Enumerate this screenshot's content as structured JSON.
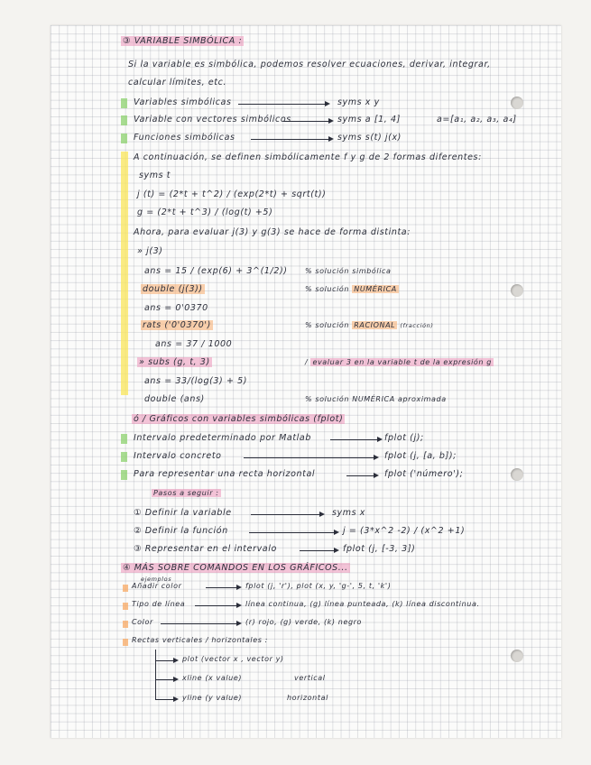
{
  "section3": {
    "title": "③ VARIABLE SIMBÓLICA :",
    "intro1": "Si la variable es simbólica, podemos resolver ecuaciones, derivar, integrar,",
    "intro2": "calcular límites, etc.",
    "items": [
      {
        "left": "Variables simbólicas",
        "right": "syms  x  y",
        "extra": ""
      },
      {
        "left": "Variable con vectores simbólicos",
        "right": "syms  a [1, 4]",
        "extra": "a=[a₁, a₂, a₃, a₄]"
      },
      {
        "left": "Funciones simbólicas",
        "right": "syms  s(t)  j(x)",
        "extra": ""
      }
    ],
    "cont": "A continuación, se definen simbólicamente  f  y  g  de 2 formas diferentes:",
    "syms_t": "syms  t",
    "f_def": "j (t) = (2*t + t^2) / (exp(2*t) + sqrt(t))",
    "g_def": "g = (2*t + t^3) / (log(t) +5)",
    "eval": "Ahora, para evaluar  j(3)  y  g(3)  se hace de forma distinta:",
    "j3": "» j(3)",
    "ans1": "ans =   15 / (exp(6)  +  3^(1/2))",
    "ans1_c": "% solución simbólica",
    "double_cmd": "double (j(3))",
    "double_c_pre": "% solución",
    "double_c_hl": "NUMÉRICA",
    "ans2": "ans =  0'0370",
    "rats_cmd": "rats ('0'0370')",
    "rats_c_pre": "% solución",
    "rats_c_hl": "RACIONAL",
    "rats_c_post": "(fracción)",
    "ans3": "ans =  37 / 1000",
    "subs_cmd": "» subs (g, t, 3)",
    "subs_c_pre": "/",
    "subs_c_hl": "evaluar  3  en la variable t de la expresión g",
    "ans4": "ans =  33/(log(3) + 5)",
    "double_ans": "double (ans)",
    "double_ans_c": "% solución NUMÉRICA aproximada"
  },
  "graficos": {
    "title": "ó / Gráficos con variables simbólicas (fplot)",
    "items": [
      {
        "left": "Intervalo predeterminado por Matlab",
        "right": "fplot (j);"
      },
      {
        "left": "Intervalo concreto",
        "right": "fplot (j, [a, b]);"
      },
      {
        "left": "Para representar una recta horizontal",
        "right": "fplot ('número');"
      }
    ],
    "pasos_title": "Pasos a seguir :",
    "pasos": [
      {
        "left": "① Definir la variable",
        "right": "syms  x"
      },
      {
        "left": "② Definir la función",
        "right": "j = (3*x^2 -2) / (x^2 +1)"
      },
      {
        "left": "③ Representar en el intervalo",
        "right": "fplot (j, [-3, 3])"
      }
    ]
  },
  "section4": {
    "title": "④ MÁS SOBRE COMANDOS EN LOS GRÁFICOS...",
    "ejemplos": "ejemplos",
    "items": [
      {
        "left": "Añadir color",
        "right": "fplot (j, 'r'),   plot (x, y, 'g-', 5, t, 'k')"
      },
      {
        "left": "Tipo de línea",
        "right": "línea continua,  (g) línea punteada,  (k) línea discontinua."
      },
      {
        "left": "Color",
        "right": "(r) rojo,  (g) verde,  (k) negro"
      }
    ],
    "rectas_title": "Rectas verticales / horizontales :",
    "rectas": [
      {
        "cmd": "plot (vector x , vector y)",
        "note": ""
      },
      {
        "cmd": "xline  (x value)",
        "note": "vertical"
      },
      {
        "cmd": "yline  (y value)",
        "note": "horizontal"
      }
    ]
  },
  "colors": {
    "paper": "#fbfbfa",
    "grid": "#8b90a0",
    "ink": "#2b2e3a",
    "pink": "#ec96ba",
    "orange": "#f8b278",
    "yellow": "#fae86e",
    "green": "#96dc78"
  }
}
